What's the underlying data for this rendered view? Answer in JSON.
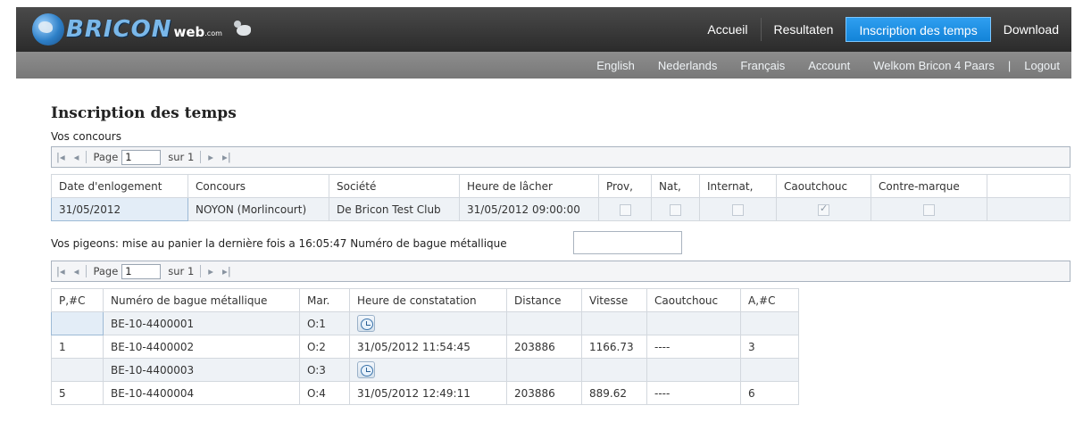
{
  "header": {
    "logo": {
      "brand": "BRICON",
      "web": "web",
      "com": ".com"
    },
    "nav": [
      "Accueil",
      "Resultaten",
      "Inscription des temps",
      "Download"
    ],
    "active_nav": "Inscription des temps"
  },
  "subnav": {
    "items": [
      "English",
      "Nederlands",
      "Français",
      "Account"
    ],
    "welcome": "Welkom Bricon 4 Paars",
    "separator": "|",
    "logout": "Logout"
  },
  "page": {
    "title": "Inscription des temps",
    "concours_label": "Vos concours",
    "pigeons_label": "Vos pigeons: mise au panier la dernière fois a 16:05:47 Numéro de bague métallique",
    "ring_input_value": ""
  },
  "pager1": {
    "page_label": "Page",
    "page_value": "1",
    "of_label": "sur 1"
  },
  "pager2": {
    "page_label": "Page",
    "page_value": "1",
    "of_label": "sur 1"
  },
  "concours_table": {
    "columns": [
      "Date d'enlogement",
      "Concours",
      "Société",
      "Heure de lâcher",
      "Prov,",
      "Nat,",
      "Internat,",
      "Caoutchouc",
      "Contre-marque"
    ],
    "rows": [
      {
        "date": "31/05/2012",
        "concours": "NOYON (Morlincourt)",
        "societe": "De Bricon Test Club",
        "heure": "31/05/2012 09:00:00",
        "prov": false,
        "nat": false,
        "internat": false,
        "caoutchouc": true,
        "contremarque": false
      }
    ]
  },
  "pigeons_table": {
    "columns": [
      "P,#C",
      "Numéro de bague métallique",
      "Mar.",
      "Heure de constatation",
      "Distance",
      "Vitesse",
      "Caoutchouc",
      "A,#C"
    ],
    "rows": [
      {
        "pc": "",
        "bague": "BE-10-4400001",
        "mar": "O:1",
        "heure": "",
        "clock": true,
        "distance": "",
        "vitesse": "",
        "caoutchouc": "",
        "ac": ""
      },
      {
        "pc": "1",
        "bague": "BE-10-4400002",
        "mar": "O:2",
        "heure": "31/05/2012 11:54:45",
        "clock": false,
        "distance": "203886",
        "vitesse": "1166.73",
        "caoutchouc": "----",
        "ac": "3"
      },
      {
        "pc": "",
        "bague": "BE-10-4400003",
        "mar": "O:3",
        "heure": "",
        "clock": true,
        "distance": "",
        "vitesse": "",
        "caoutchouc": "",
        "ac": ""
      },
      {
        "pc": "5",
        "bague": "BE-10-4400004",
        "mar": "O:4",
        "heure": "31/05/2012 12:49:11",
        "clock": false,
        "distance": "203886",
        "vitesse": "889.62",
        "caoutchouc": "----",
        "ac": "6"
      }
    ]
  },
  "colors": {
    "active_nav": "#1a8ee6",
    "topbar": "#333333",
    "subbar": "#838383",
    "row_alt": "#eef2f6"
  }
}
